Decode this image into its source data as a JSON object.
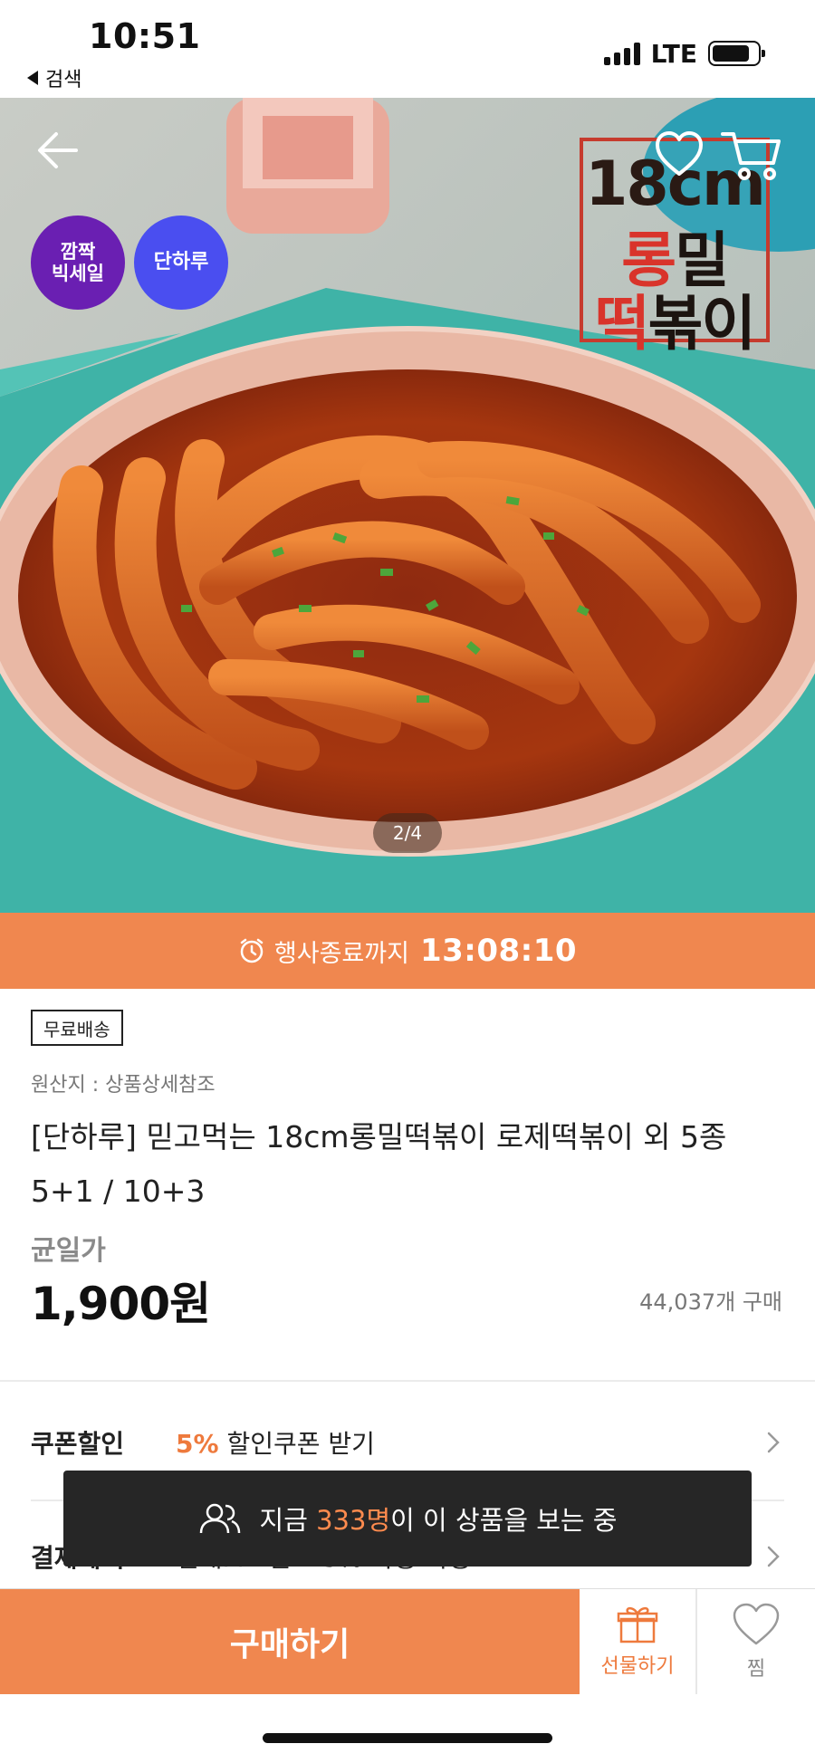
{
  "status_bar": {
    "time": "10:51",
    "back_label": "검색",
    "network": "LTE",
    "icons": [
      "signal-icon",
      "battery-icon"
    ]
  },
  "hero": {
    "badges": [
      "깜짝\n빅세일",
      "단하루"
    ],
    "sign_lines": [
      "18cm",
      "롱밀",
      "떡볶이"
    ],
    "page_indicator": "2/4",
    "icons": [
      "back-arrow-icon",
      "heart-icon",
      "cart-icon"
    ]
  },
  "countdown": {
    "label": "행사종료까지",
    "time": "13:08:10"
  },
  "product": {
    "shipping_tag": "무료배송",
    "origin": "원산지 : 상품상세참조",
    "title": "[단하루] 믿고먹는 18cm롱밀떡볶이 로제떡볶이 외 5종 5+1 / 10+3",
    "price_label": "균일가",
    "price": "1,900원",
    "sold_count": "44,037개 구매"
  },
  "benefits": {
    "coupon_label": "쿠폰할인",
    "coupon_percent": "5%",
    "coupon_text": "할인쿠폰 받기",
    "payment_label": "결제혜택",
    "payment_text": "현대M포인트 5% 사용 가능"
  },
  "toast": {
    "prefix": "지금",
    "count": "333명",
    "suffix": "이 이 상품을 보는 중"
  },
  "bottom_bar": {
    "buy_label": "구매하기",
    "gift_label": "선물하기",
    "wish_label": "찜"
  },
  "colors": {
    "accent": "#f0874f",
    "accent_text": "#ee7a3d",
    "badge_purple": "#6a1fb2",
    "badge_blue": "#4a4ef0",
    "toast_bg": "#262626"
  }
}
